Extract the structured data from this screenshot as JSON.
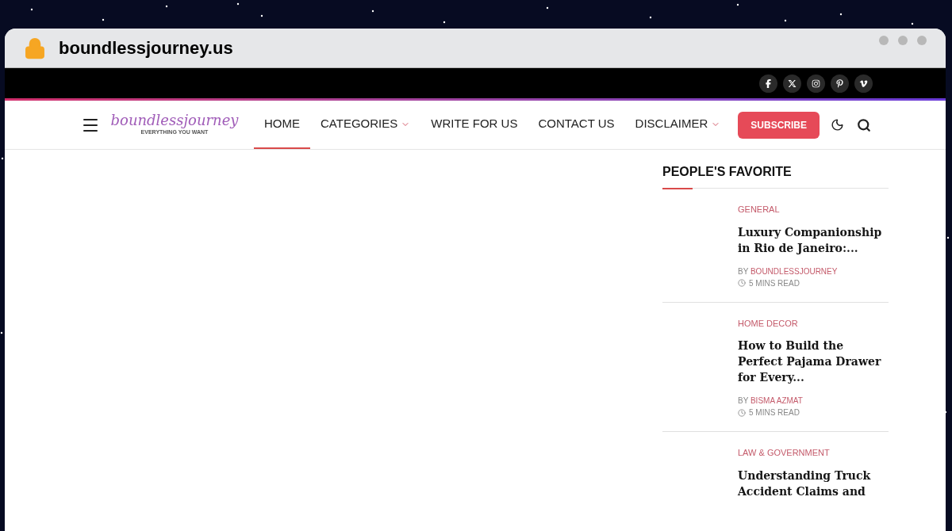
{
  "browser": {
    "url": "boundlessjourney.us"
  },
  "top_bar": {
    "socials": [
      {
        "kind": "facebook"
      },
      {
        "kind": "x"
      },
      {
        "kind": "instagram"
      },
      {
        "kind": "pinterest"
      },
      {
        "kind": "vimeo"
      }
    ]
  },
  "header": {
    "logo": {
      "name": "boundlessjourney",
      "tagline": "EVERYTHING YOU WANT"
    },
    "nav": [
      {
        "label": "HOME",
        "selected": true,
        "dropdown": false
      },
      {
        "label": "CATEGORIES",
        "selected": false,
        "dropdown": true
      },
      {
        "label": "WRITE FOR US",
        "selected": false,
        "dropdown": false
      },
      {
        "label": "CONTACT US",
        "selected": false,
        "dropdown": false
      },
      {
        "label": "DISCLAIMER",
        "selected": false,
        "dropdown": true
      }
    ],
    "subscribe": "SUBSCRIBE"
  },
  "sidebar": {
    "title": "PEOPLE'S FAVORITE",
    "posts": [
      {
        "category": "GENERAL",
        "title": "Luxury Companionship in Rio de Janeiro:...",
        "by": "BY",
        "author": "BOUNDLESSJOURNEY",
        "read": "5 MINS READ"
      },
      {
        "category": "HOME DECOR",
        "title": "How to Build the Perfect Pajama Drawer for Every...",
        "by": "BY",
        "author": "BISMA AZMAT",
        "read": "5 MINS READ"
      },
      {
        "category": "LAW & GOVERNMENT",
        "title": "Understanding Truck Accident Claims and"
      }
    ]
  }
}
